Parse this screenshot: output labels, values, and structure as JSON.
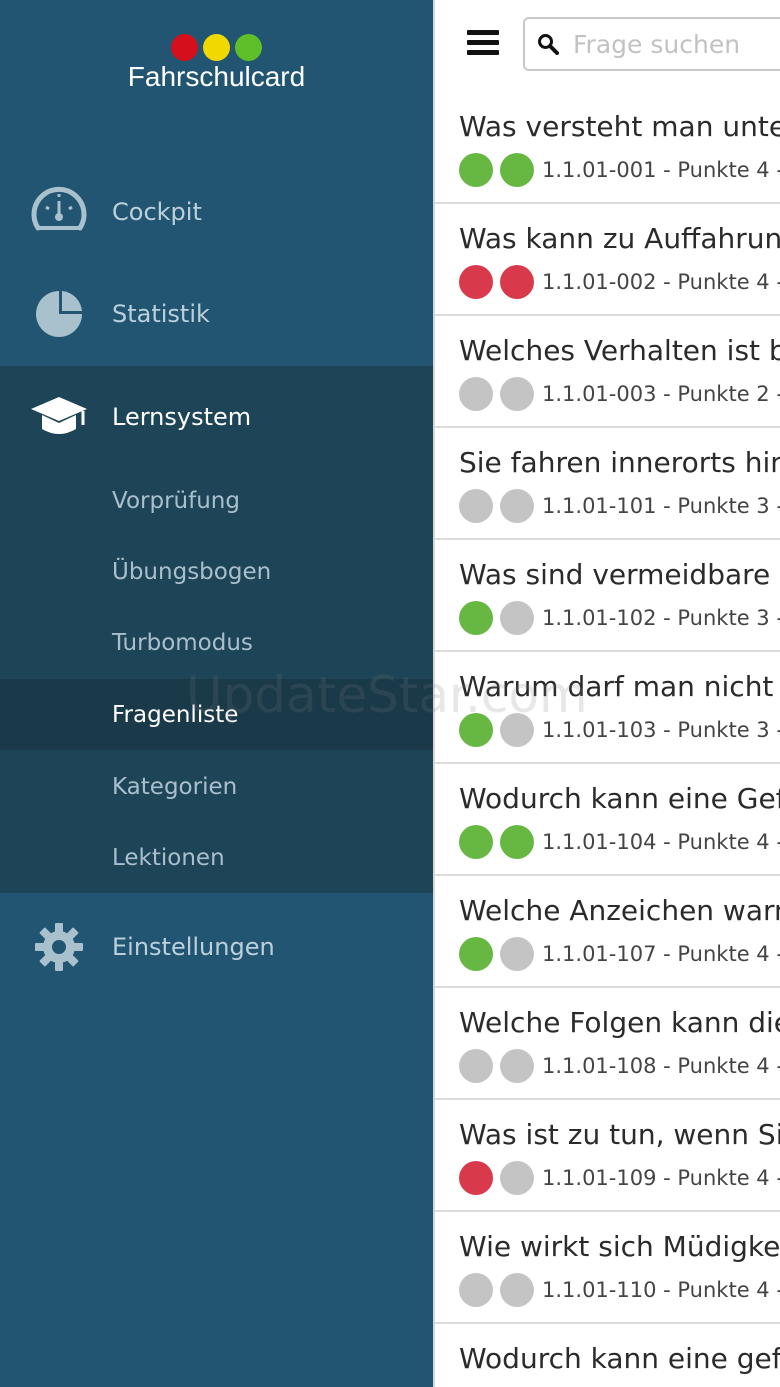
{
  "app": {
    "logo_text": "Fahrschulcard",
    "logo_dots": [
      "#d5101c",
      "#f0d800",
      "#5fbf2a"
    ]
  },
  "colors": {
    "green": "#67b843",
    "red": "#d83a4c",
    "gray": "#c4c4c4"
  },
  "sidebar": {
    "cockpit": {
      "label": "Cockpit",
      "icon": "speedometer-icon"
    },
    "statistik": {
      "label": "Statistik",
      "icon": "pie-chart-icon"
    },
    "lernsystem": {
      "label": "Lernsystem",
      "icon": "graduation-cap-icon"
    },
    "sub_items": [
      {
        "label": "Vorprüfung"
      },
      {
        "label": "Übungsbogen"
      },
      {
        "label": "Turbomodus"
      },
      {
        "label": "Fragenliste",
        "selected": true
      },
      {
        "label": "Kategorien"
      },
      {
        "label": "Lektionen"
      }
    ],
    "einstellungen": {
      "label": "Einstellungen",
      "icon": "gear-icon"
    }
  },
  "toolbar": {
    "menu_icon": "hamburger-menu-icon",
    "search_icon": "search-icon",
    "search_placeholder": "Frage suchen"
  },
  "questions": [
    {
      "title": "Was versteht man unte",
      "meta": "1.1.01-001 - Punkte 4 -",
      "status": [
        "green",
        "green"
      ]
    },
    {
      "title": "Was kann zu Auffahrunf",
      "meta": "1.1.01-002 - Punkte 4 -",
      "status": [
        "red",
        "red"
      ]
    },
    {
      "title": "Welches Verhalten ist b",
      "meta": "1.1.01-003 - Punkte 2 -",
      "status": [
        "gray",
        "gray"
      ]
    },
    {
      "title": "Sie fahren innerorts hin",
      "meta": "1.1.01-101 - Punkte 3 -",
      "status": [
        "gray",
        "gray"
      ]
    },
    {
      "title": "Was sind vermeidbare L",
      "meta": "1.1.01-102 - Punkte 3 -",
      "status": [
        "green",
        "gray"
      ]
    },
    {
      "title": "Warum darf man nicht",
      "meta": "1.1.01-103 - Punkte 3 -",
      "status": [
        "green",
        "gray"
      ]
    },
    {
      "title": "Wodurch kann eine Gef",
      "meta": "1.1.01-104 - Punkte 4 -",
      "status": [
        "green",
        "green"
      ]
    },
    {
      "title": "Welche Anzeichen warn",
      "meta": "1.1.01-107 - Punkte 4 -",
      "status": [
        "green",
        "gray"
      ]
    },
    {
      "title": "Welche Folgen kann die",
      "meta": "1.1.01-108 - Punkte 4 -",
      "status": [
        "gray",
        "gray"
      ]
    },
    {
      "title": "Was ist zu tun, wenn Sie",
      "meta": "1.1.01-109 - Punkte 4 -",
      "status": [
        "red",
        "gray"
      ]
    },
    {
      "title": "Wie wirkt sich Müdigke",
      "meta": "1.1.01-110 - Punkte 4 -",
      "status": [
        "gray",
        "gray"
      ]
    },
    {
      "title": "Wodurch kann eine gef",
      "meta": "",
      "status": []
    }
  ],
  "watermark": "UpdateStar.com"
}
